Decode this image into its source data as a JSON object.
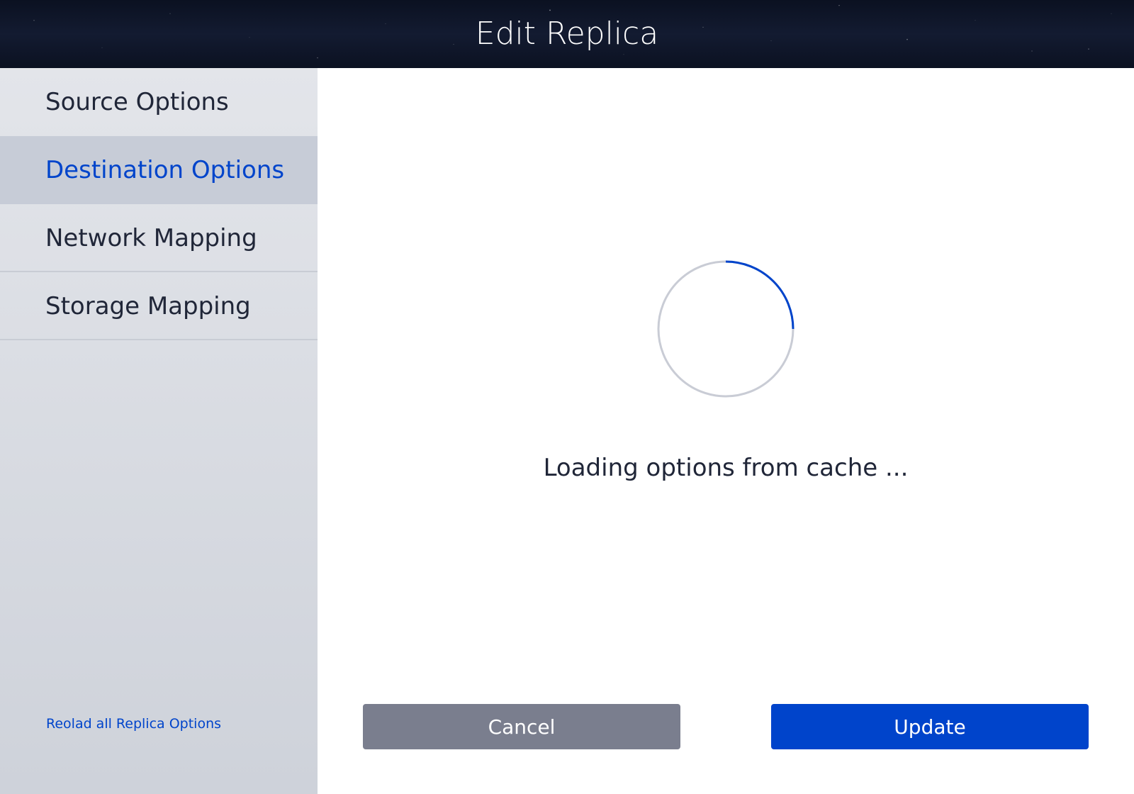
{
  "window": {
    "title": "Edit Replica"
  },
  "sidebar": {
    "items": [
      {
        "label": "Source Options"
      },
      {
        "label": "Destination Options"
      },
      {
        "label": "Network Mapping"
      },
      {
        "label": "Storage Mapping"
      }
    ],
    "selected": "Destination Options",
    "reload_link": "Reolad all  Replica Options"
  },
  "main": {
    "loading_text": "Loading options from cache ...",
    "buttons": {
      "cancel": "Cancel",
      "update": "Update"
    }
  },
  "colors": {
    "accent": "#0044cb",
    "text": "#202638",
    "cancel_button": "#7a7e8e",
    "sidebar_selected": "#c7ccd7",
    "spinner_track": "#c9ccd5"
  },
  "icons": {
    "spinner": "loading-spinner-icon"
  }
}
